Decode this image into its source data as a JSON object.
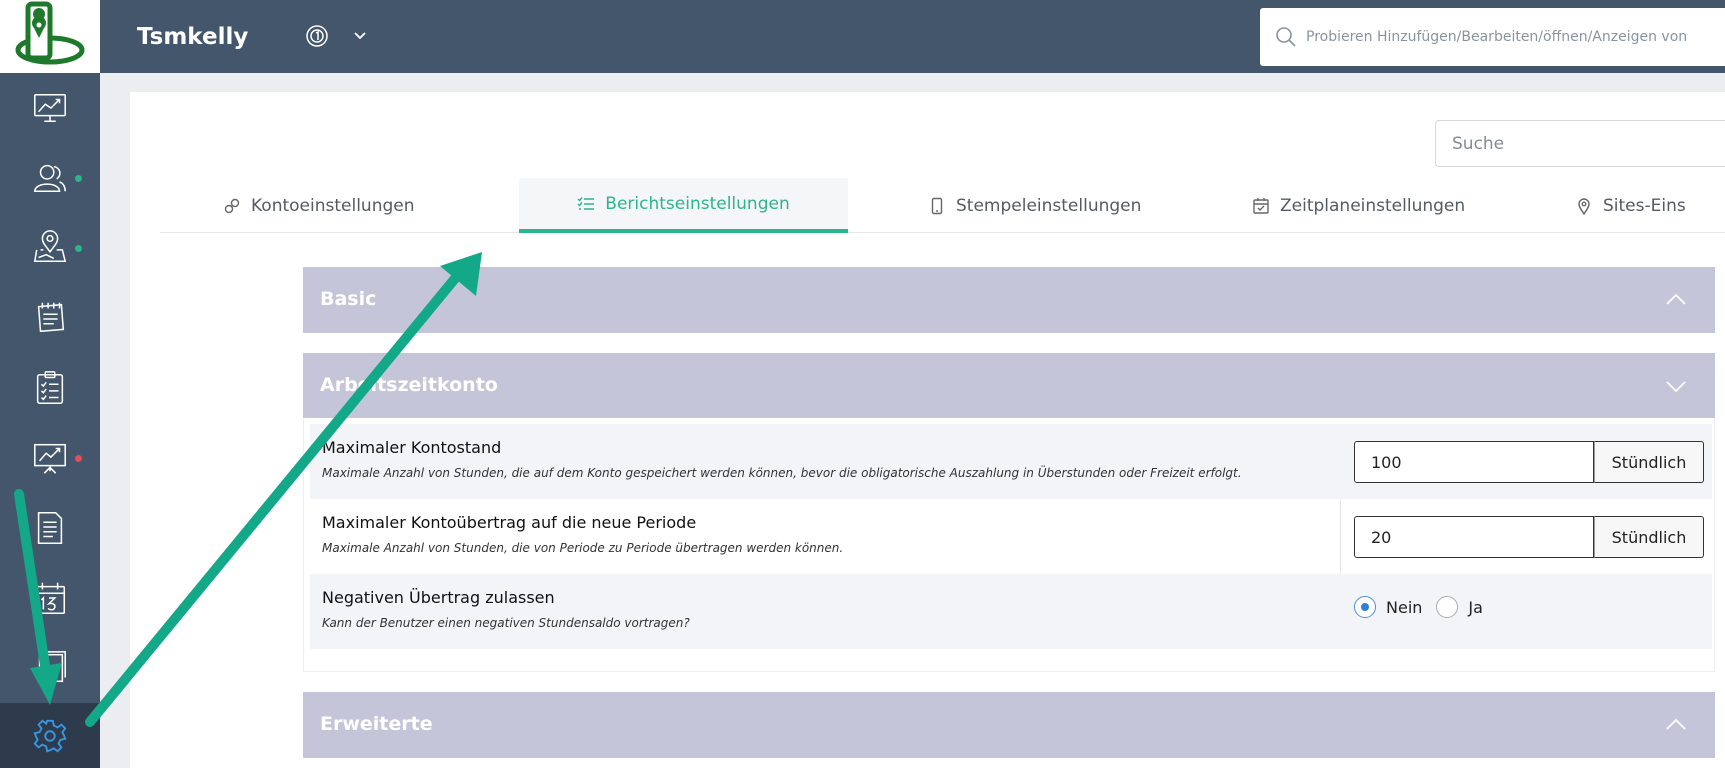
{
  "header": {
    "title": "Tsmkelly",
    "search_placeholder": "Probieren Hinzufügen/Bearbeiten/öffnen/Anzeigen von"
  },
  "sidebar": {
    "items": [
      {
        "icon": "dashboard-icon",
        "dot": null
      },
      {
        "icon": "users-icon",
        "dot": "#2bb58d"
      },
      {
        "icon": "map-pin-icon",
        "dot": "#2bb58d"
      },
      {
        "icon": "notebook-icon",
        "dot": null
      },
      {
        "icon": "clipboard-checklist-icon",
        "dot": null
      },
      {
        "icon": "presentation-chart-icon",
        "dot": "#e34c5a"
      },
      {
        "icon": "document-icon",
        "dot": null
      },
      {
        "icon": "calendar-icon",
        "dot": null
      },
      {
        "icon": "archive-icon",
        "dot": null
      },
      {
        "icon": "gear-icon",
        "dot": null,
        "active": true
      }
    ]
  },
  "search": {
    "placeholder": "Suche"
  },
  "tabs": [
    {
      "label": "Kontoeinstellungen",
      "icon": "link-icon",
      "active": false
    },
    {
      "label": "Berichtseinstellungen",
      "icon": "checklist-icon",
      "active": true
    },
    {
      "label": "Stempeleinstellungen",
      "icon": "phone-icon",
      "active": false
    },
    {
      "label": "Zeitplaneinstellungen",
      "icon": "calendar-check-icon",
      "active": false
    },
    {
      "label": "Sites-Eins",
      "icon": "location-icon",
      "active": false
    }
  ],
  "sections": {
    "basic": {
      "title": "Basic",
      "expanded": false
    },
    "arbeitszeitkonto": {
      "title": "Arbeitszeitkonto",
      "expanded": true
    },
    "erweiterte": {
      "title": "Erweiterte",
      "expanded": false
    }
  },
  "settings": {
    "max_balance": {
      "label": "Maximaler Kontostand",
      "description": "Maximale Anzahl von Stunden, die auf dem Konto gespeichert werden können, bevor die obligatorische Auszahlung in Überstunden oder Freizeit erfolgt.",
      "value": "100",
      "unit": "Stündlich"
    },
    "max_carryover": {
      "label": "Maximaler Kontoübertrag auf die neue Periode",
      "description": "Maximale Anzahl von Stunden, die von Periode zu Periode übertragen werden können.",
      "value": "20",
      "unit": "Stündlich"
    },
    "negative_carryover": {
      "label": "Negativen Übertrag zulassen",
      "description": "Kann der Benutzer einen negativen Stundensaldo vortragen?",
      "options": [
        "Nein",
        "Ja"
      ],
      "selected": "Nein"
    }
  },
  "colors": {
    "accent": "#2bb58d",
    "header_bg": "#44566c",
    "section_bar": "#c4c5d8",
    "arrow": "#12a888"
  }
}
